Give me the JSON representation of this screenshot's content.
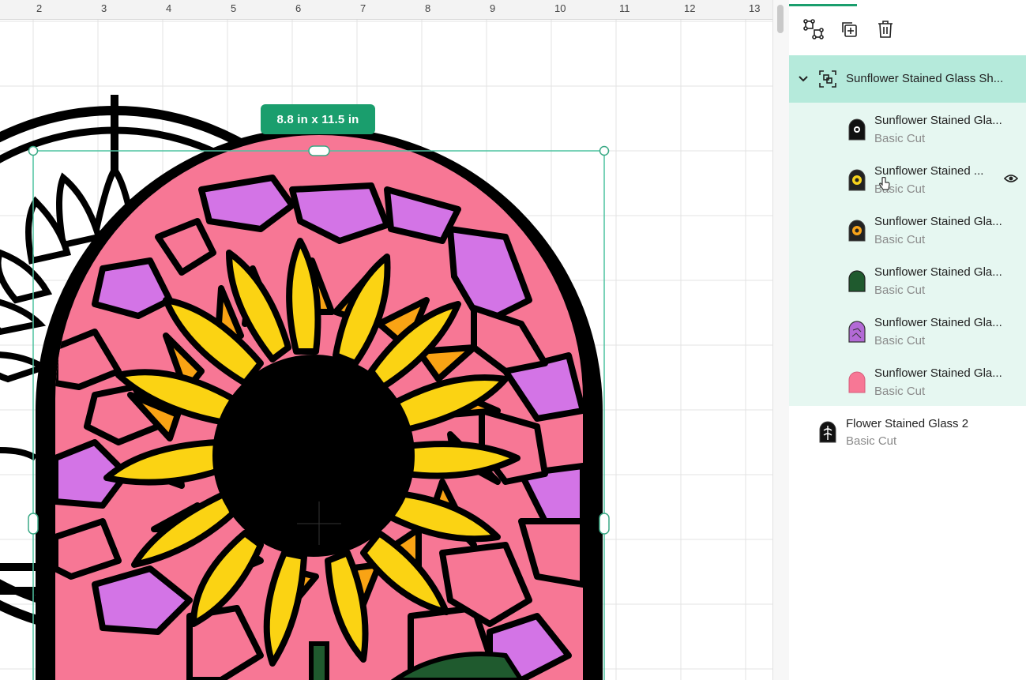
{
  "ruler": {
    "labels": [
      "2",
      "3",
      "4",
      "5",
      "6",
      "7",
      "8",
      "9",
      "10",
      "11",
      "12",
      "13"
    ]
  },
  "selection": {
    "size_label": "8.8  in x 11.5  in"
  },
  "toolbar": {
    "ungroup_icon": "ungroup-icon",
    "duplicate_icon": "duplicate-icon",
    "delete_icon": "trash-icon"
  },
  "layers": {
    "group": {
      "name": "Sunflower Stained Glass Sh...",
      "icon": "group-icon"
    },
    "children": [
      {
        "name": "Sunflower Stained Gla...",
        "operation": "Basic Cut",
        "swatch": "#111111"
      },
      {
        "name": "Sunflower Stained ...",
        "operation": "Basic Cut",
        "swatch": "#f7d21c"
      },
      {
        "name": "Sunflower Stained Gla...",
        "operation": "Basic Cut",
        "swatch": "#f6a21a"
      },
      {
        "name": "Sunflower Stained Gla...",
        "operation": "Basic Cut",
        "swatch": "#1f5a2e"
      },
      {
        "name": "Sunflower Stained Gla...",
        "operation": "Basic Cut",
        "swatch": "#b36ad6"
      },
      {
        "name": "Sunflower Stained Gla...",
        "operation": "Basic Cut",
        "swatch": "#f77795"
      }
    ],
    "other": {
      "name": "Flower Stained Glass 2",
      "operation": "Basic Cut"
    }
  },
  "colors": {
    "accent": "#1a9e6d",
    "group_bg": "#b5eadb",
    "children_bg": "#e6f7f1",
    "pink": "#f77795",
    "purple": "#d374e6",
    "yellow": "#fbd313",
    "orange": "#f9a314",
    "green": "#1f5a2e"
  }
}
